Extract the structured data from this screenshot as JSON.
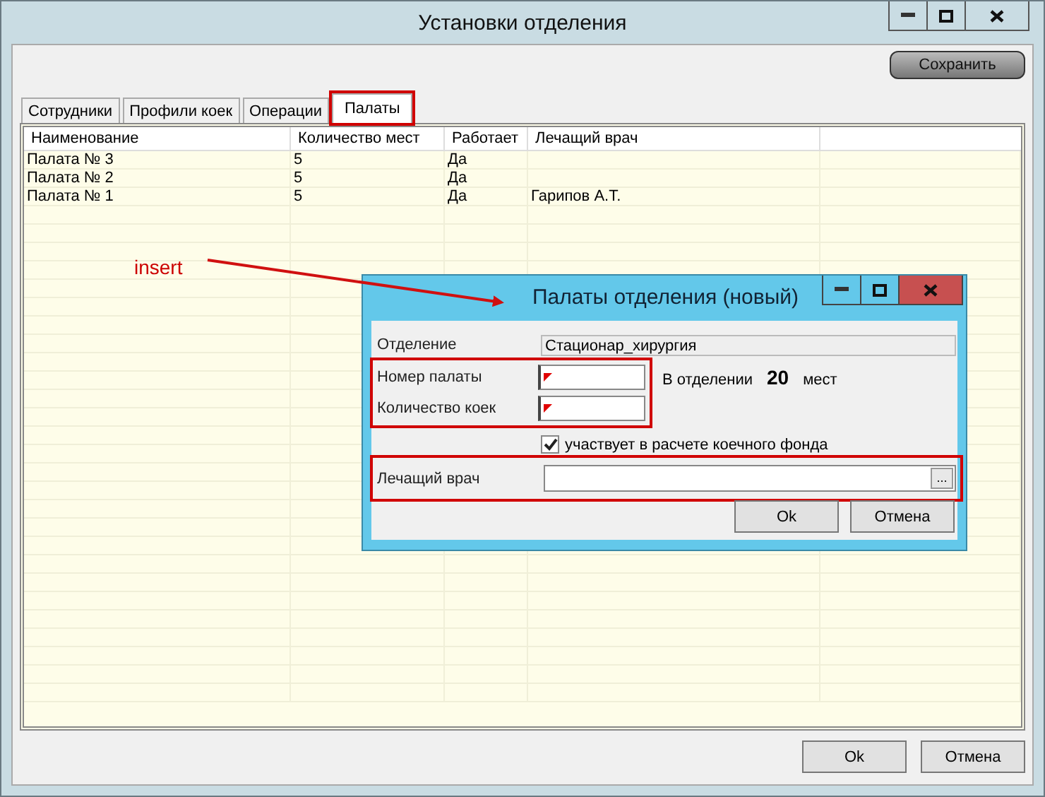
{
  "window": {
    "title": "Установки отделения"
  },
  "save_button": "Сохранить",
  "tabs": [
    {
      "label": "Сотрудники",
      "selected": false,
      "highlighted": false
    },
    {
      "label": "Профили коек",
      "selected": false,
      "highlighted": false
    },
    {
      "label": "Операции",
      "selected": false,
      "highlighted": false
    },
    {
      "label": "Палаты",
      "selected": true,
      "highlighted": true
    }
  ],
  "table": {
    "columns": [
      "Наименование",
      "Количество мест",
      "Работает",
      "Лечащий врач"
    ],
    "rows": [
      [
        "Палата № 3",
        "5",
        "Да",
        ""
      ],
      [
        "Палата № 2",
        "5",
        "Да",
        ""
      ],
      [
        "Палата № 1",
        "5",
        "Да",
        "Гарипов А.Т."
      ]
    ]
  },
  "buttons": [
    "Ok",
    "Отмена"
  ],
  "annotation": {
    "label": "insert"
  },
  "dialog": {
    "title": "Палаты отделения (новый)",
    "department_label": "Отделение",
    "department_value": "Стационар_хирургия",
    "room_label": "Номер палаты",
    "beds_label": "Количество коек",
    "in_dept_label": "В отделении",
    "in_dept_count": "20",
    "in_dept_unit": "мест",
    "checkbox": {
      "label": "участвует в расчете коечного фонда",
      "checked": true
    },
    "doctor_label": "Лечащий врач",
    "browse": "...",
    "buttons": [
      "Ok",
      "Отмена"
    ]
  }
}
